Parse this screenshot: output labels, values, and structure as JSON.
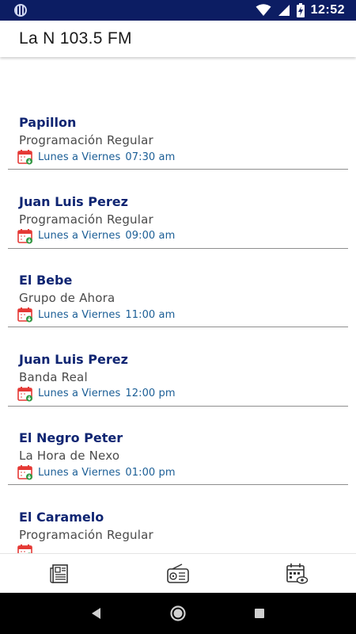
{
  "status_bar": {
    "time": "12:52"
  },
  "app_bar": {
    "title": "La N 103.5 FM"
  },
  "schedule": [
    {
      "name": "Papillon",
      "program": "Programación Regular",
      "days": "Lunes a Viernes",
      "time": "07:30 am"
    },
    {
      "name": "Juan Luis Perez",
      "program": "Programación Regular",
      "days": "Lunes a Viernes",
      "time": "09:00 am"
    },
    {
      "name": "El Bebe",
      "program": "Grupo de Ahora",
      "days": "Lunes a Viernes",
      "time": "11:00 am"
    },
    {
      "name": "Juan Luis Perez",
      "program": "Banda Real",
      "days": "Lunes a Viernes",
      "time": "12:00 pm"
    },
    {
      "name": "El Negro Peter",
      "program": "La Hora de Nexo",
      "days": "Lunes a Viernes",
      "time": "01:00 pm"
    },
    {
      "name": "El Caramelo",
      "program": "Programación Regular",
      "days": "",
      "time": ""
    }
  ],
  "bottom_nav": {
    "items": [
      {
        "icon": "news-icon"
      },
      {
        "icon": "radio-icon"
      },
      {
        "icon": "schedule-calendar-icon"
      }
    ]
  },
  "colors": {
    "status_bar": "#0c1d63",
    "title_text": "#0f2572",
    "schedule_text": "#1b5e96",
    "calendar_red": "#e53935",
    "calendar_green": "#2e9b45"
  }
}
